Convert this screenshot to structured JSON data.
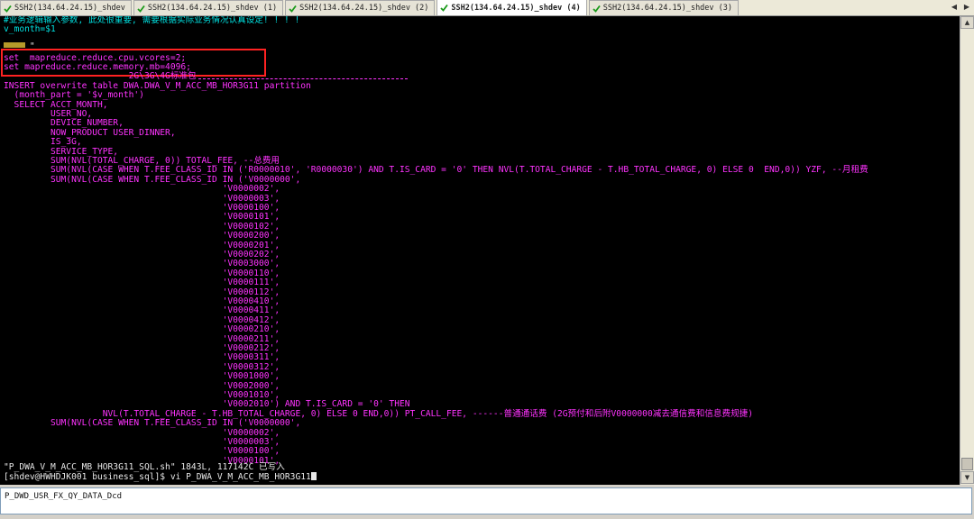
{
  "tabs": [
    {
      "label": "SSH2(134.64.24.15)_shdev"
    },
    {
      "label": "SSH2(134.64.24.15)_shdev (1)"
    },
    {
      "label": "SSH2(134.64.24.15)_shdev (2)"
    },
    {
      "label": "SSH2(134.64.24.15)_shdev (4)",
      "active": true
    },
    {
      "label": "SSH2(134.64.24.15)_shdev (3)"
    }
  ],
  "terminal": {
    "lines": [
      "#业务逻辑输入参数, 此处很重要, 需要根据实际业务情况认真设定! ! ! !",
      "v_month=$1",
      "",
      "     \"",
      "set  mapreduce.reduce.cpu.vcores=2;",
      "set mapreduce.reduce.memory.mb=4096;",
      "                        2G\\3G\\4G标准包",
      "INSERT overwrite table DWA.DWA_V_M_ACC_MB_HOR3G11 partition",
      "  (month_part = '$v_month')",
      "  SELECT ACCT_MONTH,",
      "         USER_NO,",
      "         DEVICE_NUMBER,",
      "         NOW_PRODUCT USER_DINNER,",
      "         IS_3G,",
      "         SERVICE_TYPE,",
      "         SUM(NVL(TOTAL_CHARGE, 0)) TOTAL_FEE, --总费用",
      "         SUM(NVL(CASE WHEN T.FEE_CLASS_ID IN ('R0000010', 'R0000030') AND T.IS_CARD = '0' THEN NVL(T.TOTAL_CHARGE - T.HB_TOTAL_CHARGE, 0) ELSE 0  END,0)) YZF, --月租费",
      "         SUM(NVL(CASE WHEN T.FEE_CLASS_ID IN ('V0000000',",
      "                                          'V0000002',",
      "                                          'V0000003',",
      "                                          'V0000100',",
      "                                          'V0000101',",
      "                                          'V0000102',",
      "                                          'V0000200',",
      "                                          'V0000201',",
      "                                          'V0000202',",
      "                                          'V0003000',",
      "                                          'V0000110',",
      "                                          'V0000111',",
      "                                          'V0000112',",
      "                                          'V0000410',",
      "                                          'V0000411',",
      "                                          'V0000412',",
      "                                          'V0000210',",
      "                                          'V0000211',",
      "                                          'V0000212',",
      "                                          'V0000311',",
      "                                          'V0000312',",
      "                                          'V0001000',",
      "                                          'V0002000',",
      "                                          'V0001010',",
      "                                          'V0002010') AND T.IS_CARD = '0' THEN",
      "                   NVL(T.TOTAL_CHARGE - T.HB_TOTAL_CHARGE, 0) ELSE 0 END,0)) PT_CALL_FEE, ------普通通话费 (2G预付和后附V0000000减去通信费和信息费规捷)",
      "         SUM(NVL(CASE WHEN T.FEE_CLASS_ID IN ('V0000000',",
      "                                          'V0000002',",
      "                                          'V0000003',",
      "                                          'V0000100',",
      "                                          'V0000101',",
      "\"P_DWA_V_M_ACC_MB_HOR3G11_SQL.sh\" 1843L, 117142C 已写入",
      "[shdev@HWHDJK001 business_sql]$ vi P_DWA_V_M_ACC_MB_HOR3G11"
    ]
  },
  "command_window": {
    "value": "P_DWD_USR_FX_QY_DATA_Dcd"
  },
  "colors": {
    "terminal_bg": "#000000",
    "comment_cyan": "#00e0e0",
    "sql_magenta": "#ff33ff",
    "shell_white": "#e8e8e8",
    "highlight_box": "#ff2222"
  }
}
